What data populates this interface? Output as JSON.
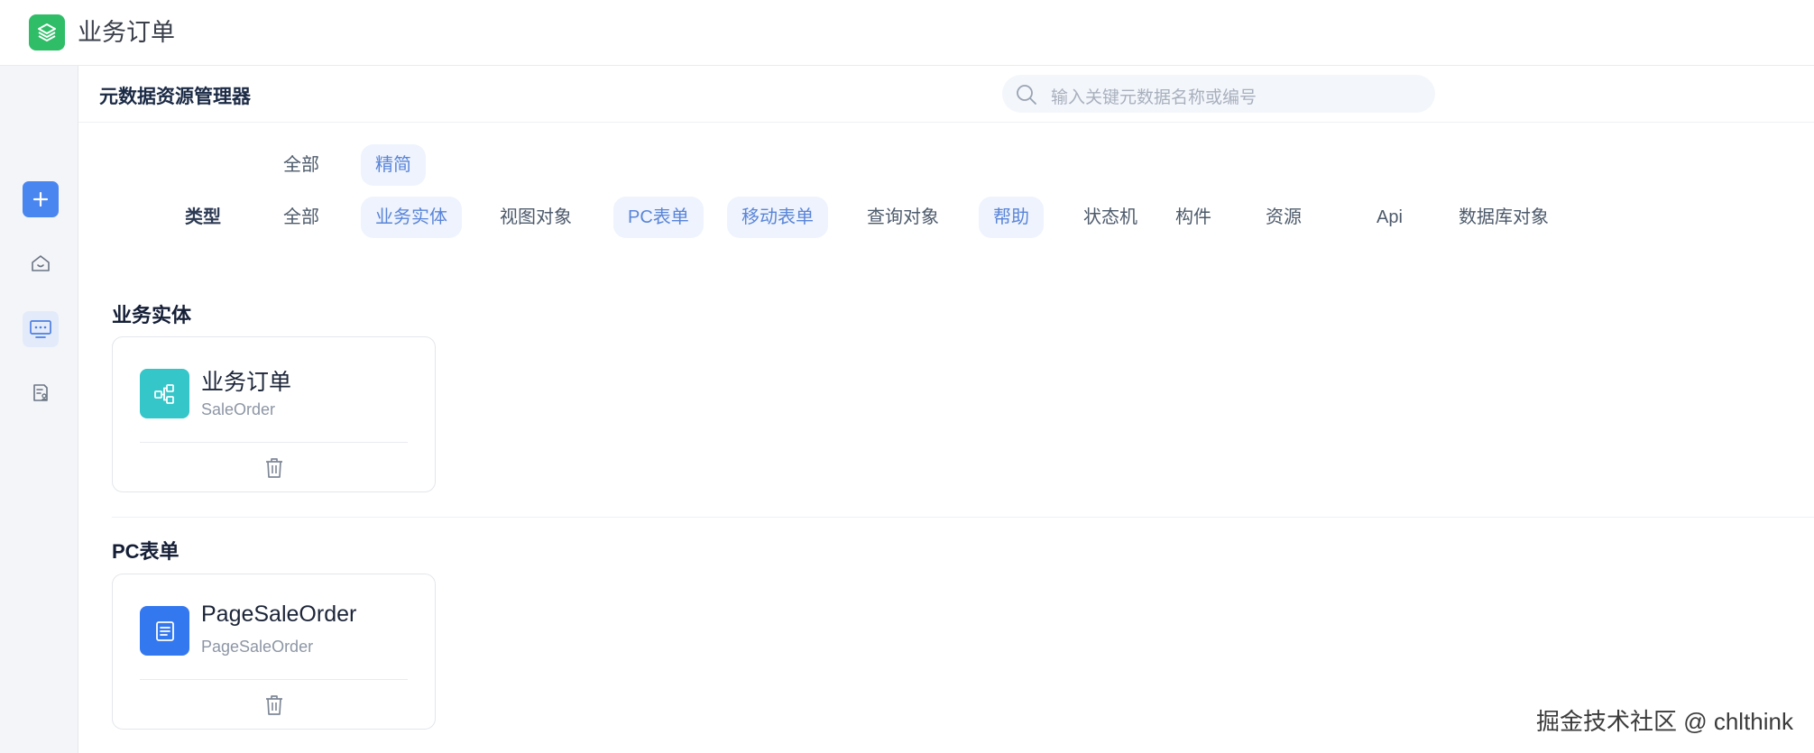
{
  "header": {
    "app_title": "业务订单",
    "logo_icon": "layers-icon",
    "logo_color": "#2fbd68"
  },
  "rail": {
    "items": [
      {
        "icon": "plus-icon",
        "name": "add"
      },
      {
        "icon": "home-icon",
        "name": "home"
      },
      {
        "icon": "monitor-icon",
        "name": "monitor",
        "active": true
      },
      {
        "icon": "document-user-icon",
        "name": "doc"
      }
    ]
  },
  "main": {
    "title": "元数据资源管理器",
    "search": {
      "placeholder": "输入关键元数据名称或编号"
    }
  },
  "filters": {
    "mode": [
      {
        "label": "全部",
        "active": false
      },
      {
        "label": "精简",
        "active": true
      }
    ],
    "type_label": "类型",
    "types": [
      {
        "label": "全部",
        "active": false
      },
      {
        "label": "业务实体",
        "active": true
      },
      {
        "label": "视图对象",
        "active": false
      },
      {
        "label": "PC表单",
        "active": true
      },
      {
        "label": "移动表单",
        "active": true
      },
      {
        "label": "查询对象",
        "active": false
      },
      {
        "label": "帮助",
        "active": true
      },
      {
        "label": "状态机",
        "active": false
      },
      {
        "label": "构件",
        "active": false
      },
      {
        "label": "资源",
        "active": false
      },
      {
        "label": "Api",
        "active": false
      },
      {
        "label": "数据库对象",
        "active": false
      }
    ]
  },
  "sections": [
    {
      "title": "业务实体",
      "cards": [
        {
          "name": "业务订单",
          "code": "SaleOrder",
          "icon": "entity-relation-icon",
          "icon_color": "#34c6c9"
        }
      ]
    },
    {
      "title": "PC表单",
      "cards": [
        {
          "name": "PageSaleOrder",
          "code": "PageSaleOrder",
          "icon": "form-page-icon",
          "icon_color": "#3478f0"
        }
      ]
    }
  ],
  "watermark": "掘金技术社区 @ chlthink",
  "colors": {
    "accent": "#4a86f0",
    "chip_active_bg": "#eef3fd",
    "chip_active_text": "#5a85d8"
  }
}
